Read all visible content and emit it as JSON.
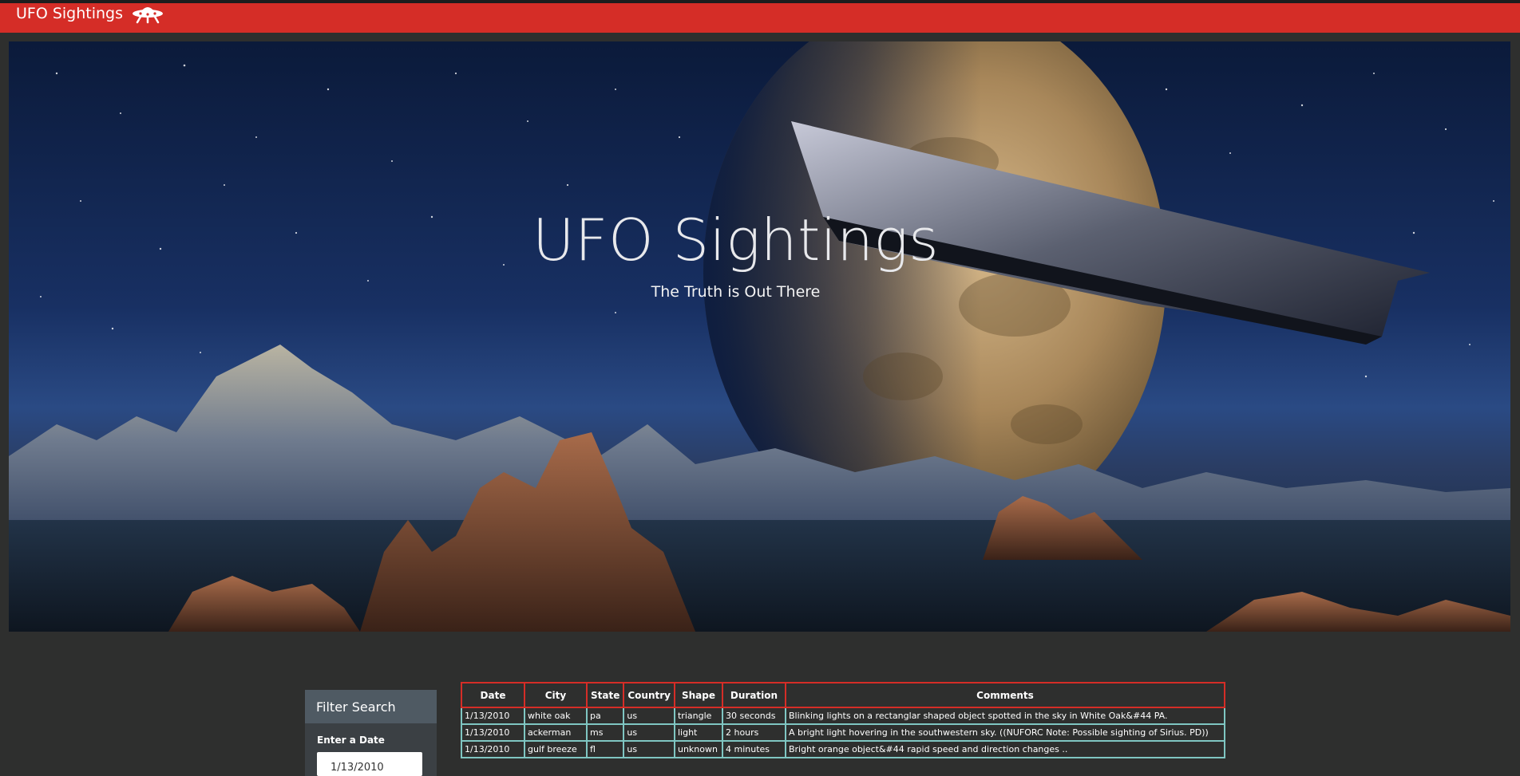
{
  "navbar": {
    "brand": "UFO Sightings",
    "icon": "ufo-icon"
  },
  "hero": {
    "title": "UFO Sightings",
    "subtitle": "The Truth is Out There"
  },
  "filter": {
    "heading": "Filter Search",
    "date_label": "Enter a Date",
    "date_value": "1/13/2010"
  },
  "table": {
    "headers": [
      "Date",
      "City",
      "State",
      "Country",
      "Shape",
      "Duration",
      "Comments"
    ],
    "rows": [
      [
        "1/13/2010",
        "white oak",
        "pa",
        "us",
        "triangle",
        "30 seconds",
        "Blinking lights on a rectanglar shaped object spotted in the sky in White Oak&#44 PA."
      ],
      [
        "1/13/2010",
        "ackerman",
        "ms",
        "us",
        "light",
        "2 hours",
        "A bright light hovering in the southwestern sky. ((NUFORC Note: Possible sighting of Sirius. PD))"
      ],
      [
        "1/13/2010",
        "gulf breeze",
        "fl",
        "us",
        "unknown",
        "4 minutes",
        "Bright orange object&#44 rapid speed and direction changes .."
      ]
    ]
  },
  "colors": {
    "navbar": "#d52d27",
    "background": "#2e2f2e",
    "table_header_border": "#d52d27",
    "table_cell_border": "#7fc6c2"
  }
}
